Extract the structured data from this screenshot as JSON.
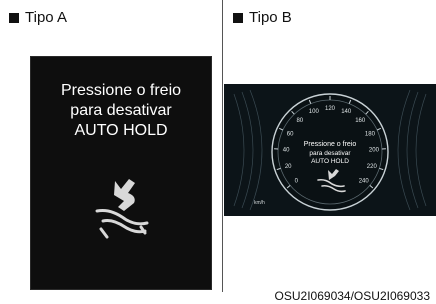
{
  "panel_a": {
    "label": "Tipo A",
    "message_lines": [
      "Pressione o freio",
      "para desativar",
      "AUTO HOLD"
    ],
    "icon": "auto-hold-icon"
  },
  "panel_b": {
    "label": "Tipo B",
    "message_lines": [
      "Pressione o freio",
      "para desativar",
      "AUTO HOLD"
    ],
    "icon": "auto-hold-icon",
    "speedometer": {
      "ticks": [
        "0",
        "20",
        "40",
        "60",
        "80",
        "100",
        "120",
        "140",
        "160",
        "180",
        "200",
        "220",
        "240"
      ],
      "unit": "km/h"
    }
  },
  "caption": "OSU2I069034/OSU2I069033",
  "colors": {
    "background": "#ffffff",
    "screen": "#0e0e0e",
    "text_on_screen": "#ffffff"
  }
}
